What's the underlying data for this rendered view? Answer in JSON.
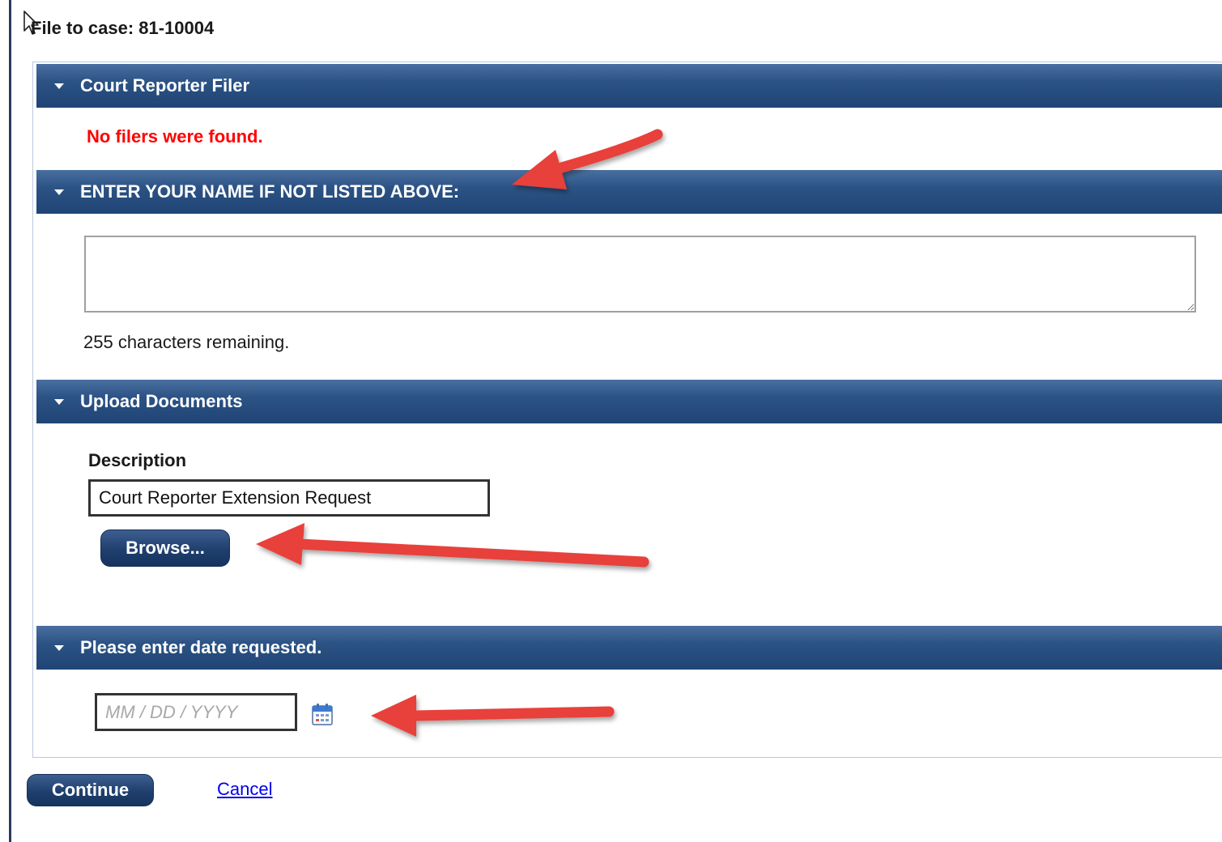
{
  "page": {
    "case_title": "File to case: 81-10004"
  },
  "sections": {
    "filer": {
      "header": "Court Reporter Filer",
      "message": "No filers were found."
    },
    "name": {
      "header": "ENTER YOUR NAME IF NOT LISTED ABOVE:",
      "value": "",
      "chars_remaining": "255 characters remaining."
    },
    "upload": {
      "header": "Upload Documents",
      "description_label": "Description",
      "description_value": "Court Reporter Extension Request",
      "browse_label": "Browse..."
    },
    "date": {
      "header": "Please enter date requested.",
      "placeholder": "MM / DD / YYYY",
      "value": ""
    }
  },
  "footer": {
    "continue_label": "Continue",
    "cancel_label": "Cancel"
  },
  "icons": {
    "collapse": "caret-down-icon",
    "calendar": "calendar-icon",
    "cursor": "mouse-pointer-icon",
    "annotation": "red-arrow-annotation"
  },
  "colors": {
    "header_bg": "#2c5385",
    "error_text": "#ff0000",
    "link": "#0000ee",
    "annotation_arrow": "#e8403a"
  }
}
